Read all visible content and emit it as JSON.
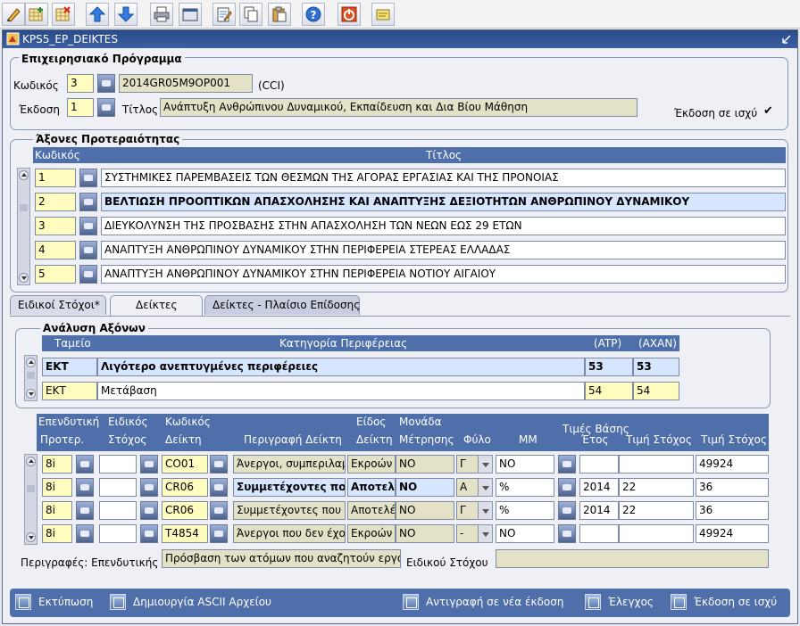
{
  "window": {
    "title": "KPS5_EP_DEIKTES"
  },
  "program": {
    "legend": "Επιχειρησιακό Πρόγραμμα",
    "code_label": "Κωδικός",
    "code_value": "3",
    "cci_value": "2014GR05M9OP001",
    "cci_label": "(CCI)",
    "version_label": "Έκδοση",
    "version_value": "1",
    "title_label": "Τίτλος",
    "title_value": "Ανάπτυξη Ανθρώπινου Δυναμικού, Εκπαίδευση και Δια Βίου Μάθηση",
    "in_force_label": "Έκδοση σε ισχύ",
    "in_force_check": "✔"
  },
  "axes": {
    "legend": "Άξονες Προτεραιότητας",
    "col_code": "Κωδικός",
    "col_title": "Τίτλος",
    "rows": [
      {
        "code": "1",
        "title": "ΣΥΣΤΗΜΙΚΕΣ ΠΑΡΕΜΒΑΣΕΙΣ ΤΩΝ ΘΕΣΜΩΝ ΤΗΣ ΑΓΟΡΑΣ ΕΡΓΑΣΙΑΣ ΚΑΙ ΤΗΣ ΠΡΟΝΟΙΑΣ"
      },
      {
        "code": "2",
        "title": "ΒΕΛΤΙΩΣΗ ΠΡΟΟΠΤΙΚΩΝ ΑΠΑΣΧΟΛΗΣΗΣ ΚΑΙ ΑΝΑΠΤΥΞΗΣ ΔΕΞΙΟΤΗΤΩΝ ΑΝΘΡΩΠΙΝΟΥ ΔΥΝΑΜΙΚΟΥ"
      },
      {
        "code": "3",
        "title": "ΔΙΕΥΚΟΛΥΝΣΗ ΤΗΣ ΠΡΟΣΒΑΣΗΣ ΣΤΗΝ ΑΠΑΣΧΟΛΗΣΗ ΤΩΝ ΝΕΩΝ ΕΩΣ 29 ΕΤΩΝ"
      },
      {
        "code": "4",
        "title": "ΑΝΑΠΤΥΞΗ ΑΝΘΡΩΠΙΝΟΥ ΔΥΝΑΜΙΚΟΥ ΣΤΗΝ ΠΕΡΙΦΕΡΕΙΑ ΣΤΕΡΕΑΣ ΕΛΛΑΔΑΣ"
      },
      {
        "code": "5",
        "title": "ΑΝΑΠΤΥΞΗ ΑΝΘΡΩΠΙΝΟΥ ΔΥΝΑΜΙΚΟΥ ΣΤΗΝ ΠΕΡΙΦΕΡΕΙΑ ΝΟΤΙΟΥ ΑΙΓΑΙΟΥ"
      }
    ]
  },
  "tabs": [
    "Ειδικοί Στόχοι*",
    "Δείκτες",
    "Δείκτες - Πλαίσιο Επίδοσης"
  ],
  "analysis": {
    "legend": "Ανάλυση Αξόνων",
    "col_fund": "Ταμείο",
    "col_region": "Κατηγορία Περιφέρειας",
    "col_atp": "(ATP)",
    "col_axan": "(AXAN)",
    "rows": [
      {
        "fund": "ΕΚΤ",
        "region": "Λιγότερο ανεπτυγμένες περιφέρειες",
        "atp": "53",
        "axan": "53"
      },
      {
        "fund": "ΕΚΤ",
        "region": "Μετάβαση",
        "atp": "54",
        "axan": "54"
      }
    ]
  },
  "indicators": {
    "h_invest": "Επενδυτική",
    "h_prio": "Προτερ.",
    "h_special": "Ειδικός",
    "h_goal": "Στόχος",
    "h_code": "Κωδικός",
    "h_indicator": "Δείκτη",
    "h_desc": "Περιγραφή Δείκτη",
    "h_type": "Είδος",
    "h_type2": "Δείκτη",
    "h_unit": "Μονάδα",
    "h_unit2": "Μέτρησης",
    "h_sex": "Φύλο",
    "h_base": "Τιμές Βάσης",
    "h_mm": "ΜΜ",
    "h_year": "Έτος",
    "h_target": "Τιμή Στόχος",
    "h_target2": "Τιμή Στόχος",
    "rows": [
      {
        "prio": "8i",
        "goal": "",
        "code": "CO01",
        "desc": "Άνεργοι, συμπεριλαμ",
        "type": "Εκροών",
        "unit": "ΝΟ",
        "sex": "Γ",
        "mm": "NO",
        "year": "",
        "base": "",
        "target": "49924"
      },
      {
        "prio": "8i",
        "goal": "",
        "code": "CR06",
        "desc": "Συμμετέχοντες που",
        "type": "Αποτελ",
        "unit": "ΝΟ",
        "sex": "Α",
        "mm": "%",
        "year": "2014",
        "base": "22",
        "target": "36"
      },
      {
        "prio": "8i",
        "goal": "",
        "code": "CR06",
        "desc": "Συμμετέχοντες που κ",
        "type": "Αποτελέ",
        "unit": "ΝΟ",
        "sex": "Γ",
        "mm": "%",
        "year": "2014",
        "base": "22",
        "target": "36"
      },
      {
        "prio": "8i",
        "goal": "",
        "code": "T4854",
        "desc": "Άνεργοι που δεν έχοι",
        "type": "Εκροών",
        "unit": "ΝΟ",
        "sex": "-",
        "mm": "NO",
        "year": "",
        "base": "",
        "target": "49924"
      }
    ],
    "desc_label": "Περιγραφές: Επενδυτικής",
    "desc_invest_value": "Πρόσβαση των ατόμων που αναζητούν εργα",
    "desc_goal_label": "Ειδικού Στόχου",
    "desc_goal_value": ""
  },
  "buttons": {
    "print": "Εκτύπωση",
    "ascii": "Δημιουργία ASCII Αρχείου",
    "copy": "Αντιγραφή σε νέα έκδοση",
    "check": "Έλεγχος",
    "in_force": "Έκδοση σε ισχύ"
  }
}
